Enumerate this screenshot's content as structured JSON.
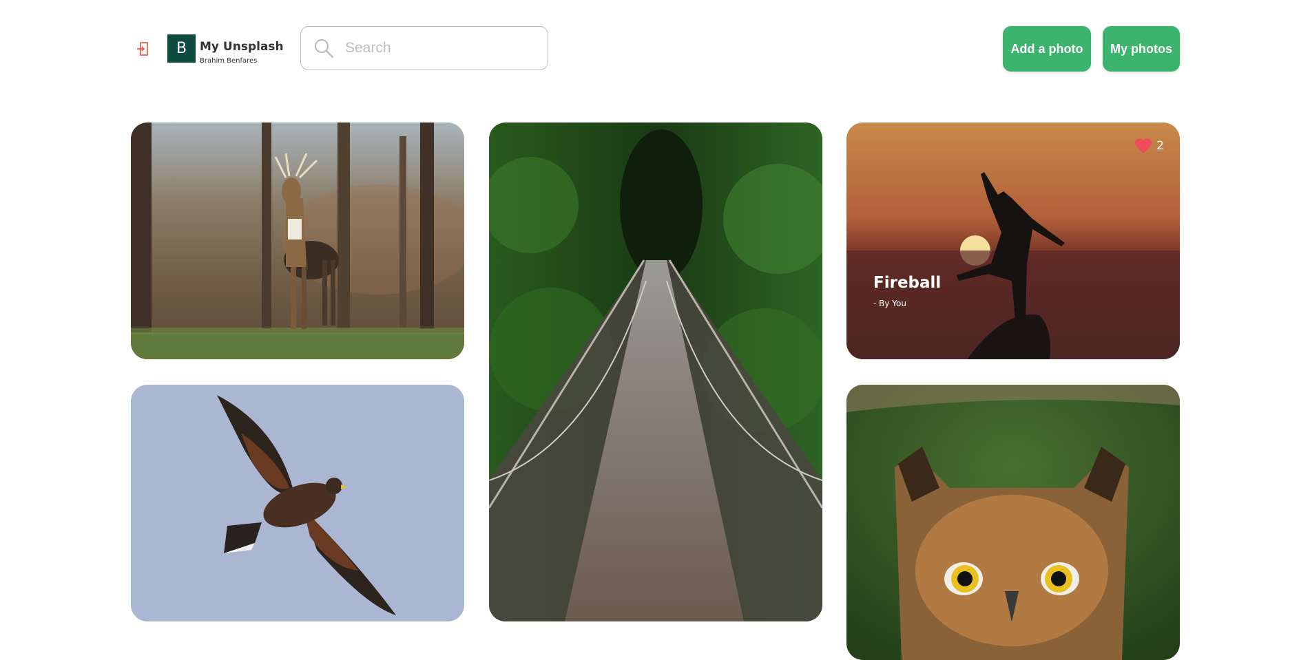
{
  "app": {
    "logo_letter": "B",
    "title": "My Unsplash",
    "subtitle": "Brahim Benfares"
  },
  "header": {
    "logout_icon": "logout-icon",
    "search_icon": "search-icon",
    "search": {
      "placeholder": "Search",
      "value": ""
    },
    "add_photo_label": "Add a photo",
    "my_photos_label": "My photos"
  },
  "colors": {
    "accent": "#3db46d",
    "logo_bg": "#0c4b3d",
    "logout_icon": "#e74c3c",
    "heart": "#ef4b5a"
  },
  "gallery": {
    "photos": [
      {
        "subject": "deer"
      },
      {
        "subject": "suspension bridge"
      },
      {
        "subject": "silhouette at sunset",
        "title": "Fireball",
        "author": "- By You",
        "likes": "2",
        "like_icon": "heart-icon"
      },
      {
        "subject": "hawk"
      },
      {
        "subject": "owl"
      }
    ]
  }
}
